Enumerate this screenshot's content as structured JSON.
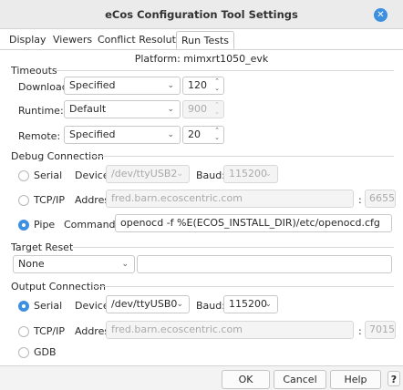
{
  "window": {
    "title": "eCos Configuration Tool Settings"
  },
  "tabs": [
    "Display",
    "Viewers",
    "Conflict Resolution",
    "Run Tests"
  ],
  "platform": "Platform: mimxrt1050_evk",
  "timeouts": {
    "title": "Timeouts",
    "rows": [
      {
        "label": "Download:",
        "mode": "Specified",
        "value": "120",
        "enabled": true
      },
      {
        "label": "Runtime:",
        "mode": "Default",
        "value": "900",
        "enabled": false
      },
      {
        "label": "Remote:",
        "mode": "Specified",
        "value": "20",
        "enabled": true
      }
    ]
  },
  "debug": {
    "title": "Debug Connection",
    "serial": {
      "label": "Serial",
      "device_label": "Device:",
      "device": "/dev/ttyUSB2",
      "baud_label": "Baud:",
      "baud": "115200"
    },
    "tcpip": {
      "label": "TCP/IP",
      "address_label": "Address:",
      "address": "fred.barn.ecoscentric.com",
      "colon": ":",
      "port": "6655"
    },
    "pipe": {
      "label": "Pipe",
      "command_label": "Command:",
      "command": "openocd -f %E(ECOS_INSTALL_DIR)/etc/openocd.cfg"
    },
    "selected": "pipe"
  },
  "target_reset": {
    "title": "Target Reset",
    "mode": "None",
    "value": ""
  },
  "output": {
    "title": "Output Connection",
    "serial": {
      "label": "Serial",
      "device_label": "Device:",
      "device": "/dev/ttyUSB0",
      "baud_label": "Baud:",
      "baud": "115200"
    },
    "tcpip": {
      "label": "TCP/IP",
      "address_label": "Address:",
      "address": "fred.barn.ecoscentric.com",
      "colon": ":",
      "port": "7015"
    },
    "gdb": {
      "label": "GDB"
    },
    "selected": "serial"
  },
  "buttons": {
    "ok": "OK",
    "cancel": "Cancel",
    "help": "Help",
    "whats_this": "?"
  },
  "colors": {
    "accent": "#3d8fe0"
  },
  "icons": {
    "close": "close-icon",
    "chevron": "chevron-down-icon",
    "spin": "spin-arrows-icon"
  }
}
